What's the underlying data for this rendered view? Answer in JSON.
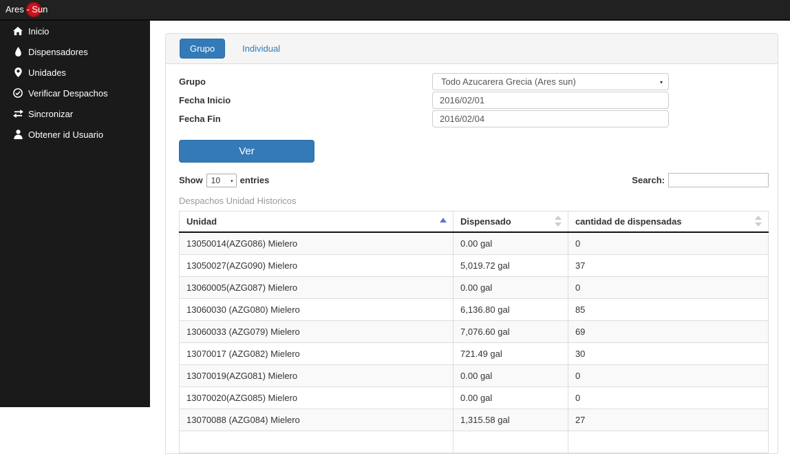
{
  "topbar": {
    "logo_text": "Ares - Sun"
  },
  "sidebar": {
    "items": [
      {
        "label": "Inicio",
        "icon": "home"
      },
      {
        "label": "Dispensadores",
        "icon": "droplet"
      },
      {
        "label": "Unidades",
        "icon": "map-marker"
      },
      {
        "label": "Verificar Despachos",
        "icon": "check-circle"
      },
      {
        "label": "Sincronizar",
        "icon": "sync-arrows"
      },
      {
        "label": "Obtener id Usuario",
        "icon": "user"
      }
    ]
  },
  "main": {
    "tabs": {
      "grupo": "Grupo",
      "individual": "Individual"
    },
    "form": {
      "grupo_label": "Grupo",
      "grupo_value": "Todo Azucarera Grecia (Ares sun)",
      "fecha_inicio_label": "Fecha Inicio",
      "fecha_inicio_value": "2016/02/01",
      "fecha_fin_label": "Fecha Fin",
      "fecha_fin_value": "2016/02/04",
      "ver_button": "Ver"
    },
    "datatable": {
      "show_label": "Show",
      "page_size": "10",
      "entries_label": "entries",
      "search_label": "Search:",
      "search_value": "",
      "caption": "Despachos Unidad Historicos",
      "columns": [
        "Unidad",
        "Dispensado",
        "cantidad de dispensadas"
      ],
      "rows": [
        [
          "13050014(AZG086) Mielero",
          "0.00 gal",
          "0"
        ],
        [
          "13050027(AZG090) Mielero",
          "5,019.72 gal",
          "37"
        ],
        [
          "13060005(AZG087) Mielero",
          "0.00 gal",
          "0"
        ],
        [
          "13060030 (AZG080) Mielero",
          "6,136.80 gal",
          "85"
        ],
        [
          "13060033 (AZG079) Mielero",
          "7,076.60 gal",
          "69"
        ],
        [
          "13070017 (AZG082) Mielero",
          "721.49 gal",
          "30"
        ],
        [
          "13070019(AZG081) Mielero",
          "0.00 gal",
          "0"
        ],
        [
          "13070020(AZG085) Mielero",
          "0.00 gal",
          "0"
        ],
        [
          "13070088 (AZG084) Mielero",
          "1,315.58 gal",
          "27"
        ]
      ],
      "partial_row": true
    }
  },
  "colors": {
    "accent": "#337ab7",
    "topbar_bg": "#212121",
    "sidebar_bg": "#1a1a1a",
    "logo_red": "#c9151e",
    "stripe": "#f9f9f9"
  }
}
